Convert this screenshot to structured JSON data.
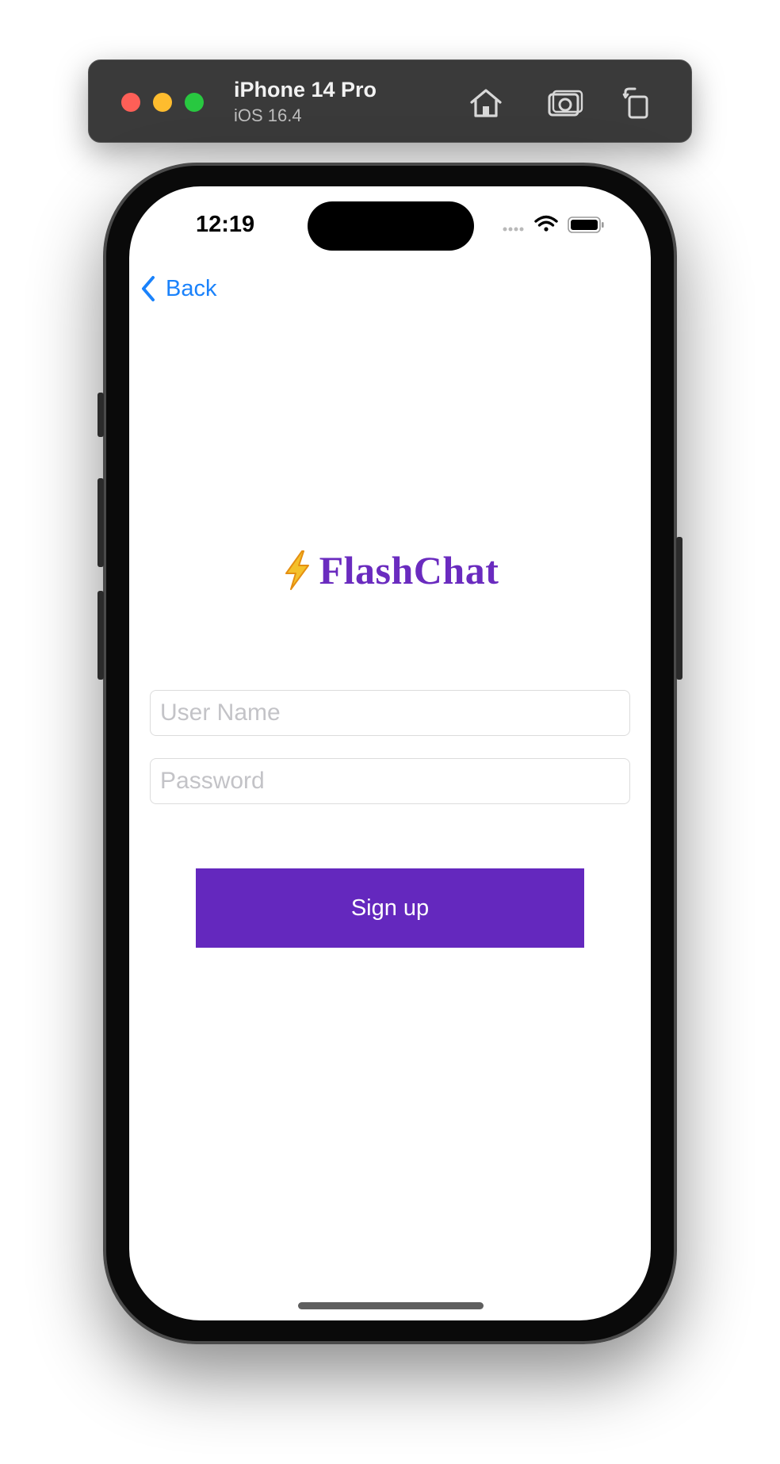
{
  "simulator": {
    "device_name": "iPhone 14 Pro",
    "os_version": "iOS 16.4",
    "icons": [
      "close-dot",
      "minimize-dot",
      "zoom-dot",
      "home-icon",
      "screenshot-icon",
      "rotate-icon"
    ],
    "colors": {
      "close": "#fe5f57",
      "minimize": "#febc2e",
      "zoom": "#28c840"
    }
  },
  "status_bar": {
    "time": "12:19",
    "icons": [
      "cellular-signal-icon",
      "wifi-icon",
      "battery-icon"
    ]
  },
  "nav": {
    "back_label": "Back",
    "back_icon": "chevron-left-icon"
  },
  "logo": {
    "emoji": "⚡",
    "text": "FlashChat",
    "color": "#6a2bbf"
  },
  "form": {
    "username_placeholder": "User Name",
    "username_value": "",
    "password_placeholder": "Password",
    "password_value": ""
  },
  "signup_button": {
    "label": "Sign up",
    "color": "#6428be"
  }
}
